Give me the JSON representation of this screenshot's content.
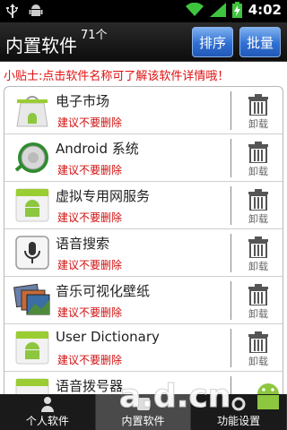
{
  "status_bar": {
    "time": "4:02",
    "icons": [
      "usb-icon",
      "android-debug-icon",
      "wifi-icon",
      "signal-icon",
      "battery-charging-icon"
    ]
  },
  "header": {
    "title": "内置软件",
    "count": "71个",
    "sort_label": "排序",
    "batch_label": "批量"
  },
  "tip": "小贴士:点击软件名称可了解该软件详情哦！",
  "apps": [
    {
      "name": "电子市场",
      "hint": "建议不要删除",
      "uninstall_label": "卸载",
      "icon": "market-icon"
    },
    {
      "name": "Android 系统",
      "hint": "建议不要删除",
      "uninstall_label": "卸载",
      "icon": "android-system-icon"
    },
    {
      "name": "虚拟专用网服务",
      "hint": "建议不要删除",
      "uninstall_label": "卸载",
      "icon": "android-app-icon"
    },
    {
      "name": "语音搜索",
      "hint": "建议不要删除",
      "uninstall_label": "卸载",
      "icon": "microphone-icon"
    },
    {
      "name": "音乐可视化壁纸",
      "hint": "建议不要删除",
      "uninstall_label": "卸载",
      "icon": "wallpaper-icon"
    },
    {
      "name": "User Dictionary",
      "hint": "建议不要删除",
      "uninstall_label": "卸载",
      "icon": "android-app-icon"
    },
    {
      "name": "语音拨号器",
      "hint": "",
      "uninstall_label": "",
      "icon": "android-app-icon"
    }
  ],
  "bottom_nav": {
    "tabs": [
      {
        "label": "个人软件",
        "icon": "person-icon",
        "active": false
      },
      {
        "label": "内置软件",
        "icon": "builtin-icon",
        "active": true
      },
      {
        "label": "功能设置",
        "icon": "settings-icon",
        "active": false
      }
    ]
  },
  "watermark": "a.d.cn",
  "colors": {
    "accent_blue": "#2f6fd3",
    "hint_red": "#d01010",
    "tip_red": "#e01010"
  }
}
